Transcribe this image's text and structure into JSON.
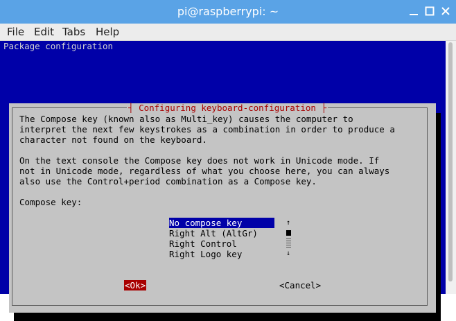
{
  "window": {
    "title": "pi@raspberrypi: ~",
    "controls": [
      "minimize-icon",
      "maximize-icon",
      "close-icon"
    ]
  },
  "menu": {
    "file": "File",
    "edit": "Edit",
    "tabs": "Tabs",
    "help": "Help"
  },
  "terminal": {
    "header": "Package configuration",
    "colors": {
      "background": "#0000a8",
      "dialog": "#c4c4c4",
      "accent": "#a80000"
    }
  },
  "dialog": {
    "title": "Configuring keyboard-configuration",
    "paragraph1": [
      "The Compose key (known also as Multi_key) causes the computer to",
      "interpret the next few keystrokes as a combination in order to produce a",
      "character not found on the keyboard."
    ],
    "paragraph2": [
      "On the text console the Compose key does not work in Unicode mode. If",
      "not in Unicode mode, regardless of what you choose here, you can always",
      "also use the Control+period combination as a Compose key."
    ],
    "prompt": "Compose key:",
    "options": [
      "No compose key",
      "Right Alt (AltGr)",
      "Right Control",
      "Right Logo key"
    ],
    "selected_option": "No compose key",
    "scroll_up": "↑",
    "scroll_down": "↓",
    "ok_label": "<Ok>",
    "cancel_label": "<Cancel>"
  }
}
